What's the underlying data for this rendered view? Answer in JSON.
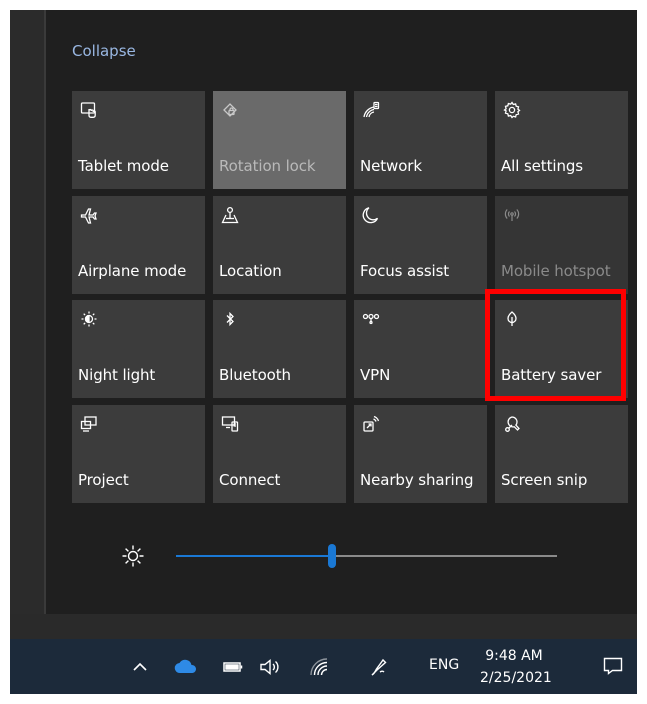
{
  "action_center": {
    "collapse_label": "Collapse",
    "tiles": [
      {
        "label": "Tablet mode",
        "icon": "tablet-mode-icon",
        "state": "off"
      },
      {
        "label": "Rotation lock",
        "icon": "rotation-lock-icon",
        "state": "on"
      },
      {
        "label": "Network",
        "icon": "network-icon",
        "state": "off"
      },
      {
        "label": "All settings",
        "icon": "gear-icon",
        "state": "off"
      },
      {
        "label": "Airplane mode",
        "icon": "airplane-icon",
        "state": "off"
      },
      {
        "label": "Location",
        "icon": "location-icon",
        "state": "off"
      },
      {
        "label": "Focus assist",
        "icon": "moon-icon",
        "state": "off"
      },
      {
        "label": "Mobile hotspot",
        "icon": "hotspot-icon",
        "state": "disabled"
      },
      {
        "label": "Night light",
        "icon": "night-light-icon",
        "state": "off"
      },
      {
        "label": "Bluetooth",
        "icon": "bluetooth-icon",
        "state": "off"
      },
      {
        "label": "VPN",
        "icon": "vpn-icon",
        "state": "off"
      },
      {
        "label": "Battery saver",
        "icon": "battery-saver-icon",
        "state": "off"
      },
      {
        "label": "Project",
        "icon": "project-icon",
        "state": "off"
      },
      {
        "label": "Connect",
        "icon": "connect-icon",
        "state": "off"
      },
      {
        "label": "Nearby sharing",
        "icon": "nearby-sharing-icon",
        "state": "off"
      },
      {
        "label": "Screen snip",
        "icon": "screen-snip-icon",
        "state": "off"
      }
    ],
    "brightness": {
      "icon": "brightness-icon",
      "level": 0.41
    },
    "highlight_target": "Battery saver",
    "highlight_color": "#ff0000",
    "accent_color": "#1a78d4"
  },
  "taskbar": {
    "tray_icons": [
      "chevron-up-icon",
      "onedrive-cloud-icon",
      "battery-icon",
      "volume-icon",
      "wifi-icon",
      "pen-icon"
    ],
    "language": "ENG",
    "time": "9:48 AM",
    "date": "2/25/2021",
    "notification_icon": "notification-icon"
  }
}
